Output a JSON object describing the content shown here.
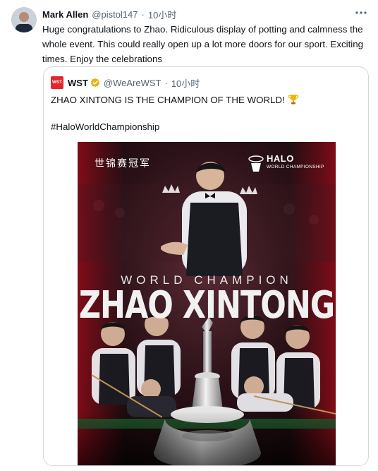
{
  "tweet": {
    "author_name": "Mark Allen",
    "author_handle": "@pistol147",
    "separator": "·",
    "time": "10小时",
    "text": "Huge congratulations to Zhao. Ridiculous display of potting and calmness the whole event. This could really open up a lot more doors for our sport. Exciting times. Enjoy the celebrations",
    "more_icon": "more-horizontal-icon"
  },
  "quote": {
    "logo_text": "WST",
    "author_name": "WST",
    "author_handle": "@WeAreWST",
    "separator": "·",
    "time": "10小时",
    "text": "ZHAO XINTONG IS THE CHAMPION OF THE WORLD!",
    "emoji": "trophy-icon",
    "hashtag": "#HaloWorldChampionship",
    "poster": {
      "chinese_caption": "世锦赛冠军",
      "brand": "HALO",
      "brand_sub": "WORLD CHAMPIONSHIP",
      "headline_small": "WORLD CHAMPION",
      "headline_big": "ZHAO XINTONG"
    }
  }
}
